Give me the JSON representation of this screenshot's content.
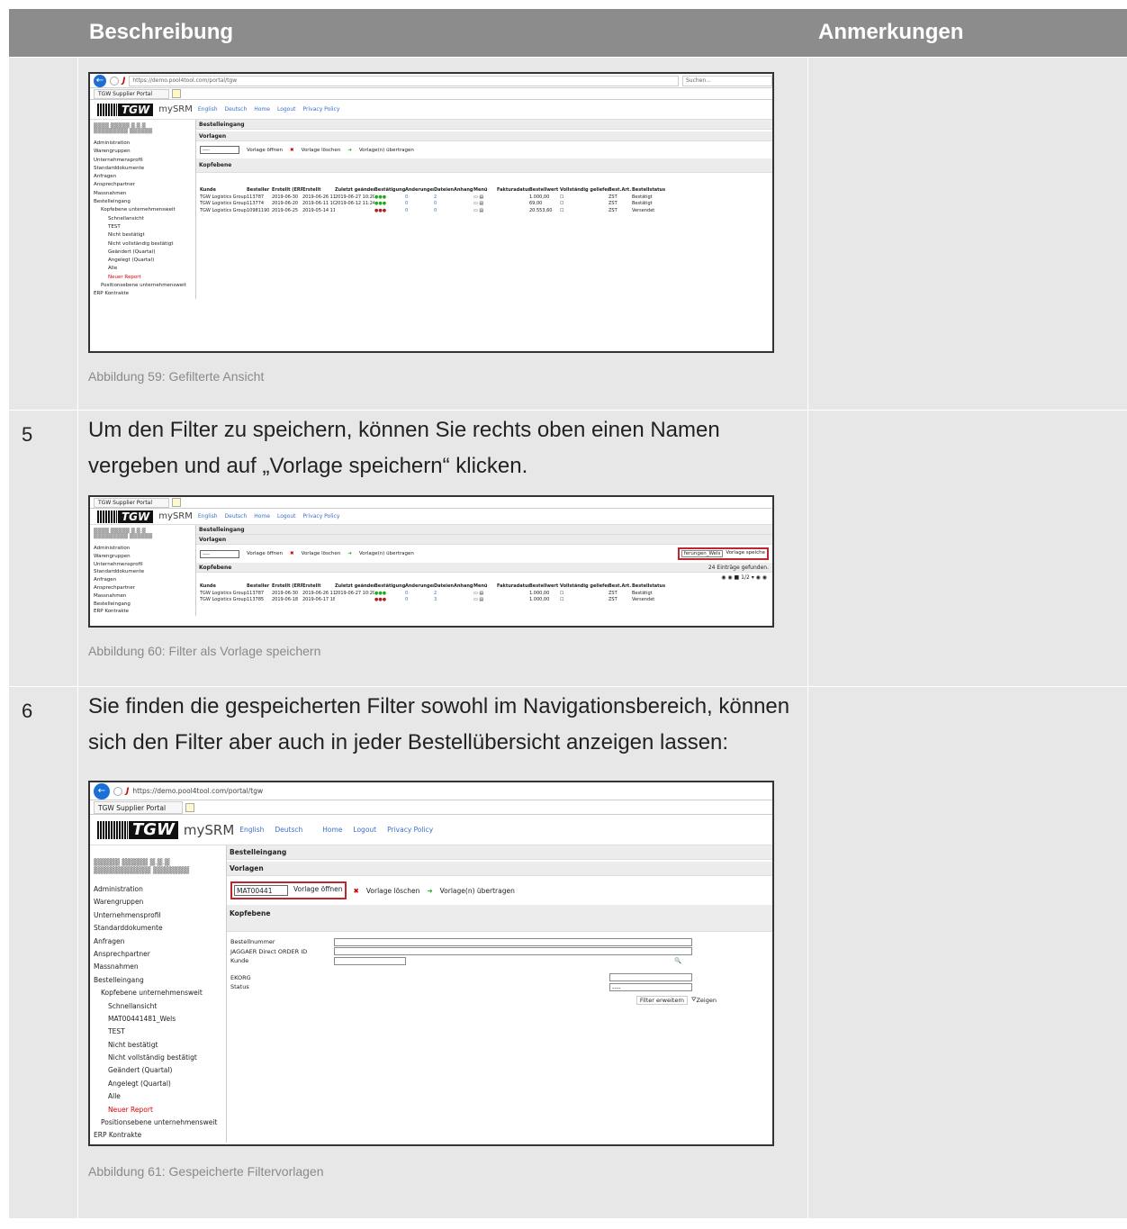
{
  "header": {
    "col_desc": "Beschreibung",
    "col_notes": "Anmerkungen"
  },
  "rows": [
    {
      "num": "",
      "text": "",
      "caption": "Abbildung 59: Gefilterte Ansicht"
    },
    {
      "num": "5",
      "text": "Um den Filter zu speichern, können Sie rechts oben einen Namen vergeben und auf „Vorlage speichern“ klicken.",
      "caption": "Abbildung 60: Filter als Vorlage speichern"
    },
    {
      "num": "6",
      "text": "Sie finden die gespeicherten Filter sowohl im Navigationsbereich, können sich den Filter aber auch in jeder Bestellübersicht anzeigen lassen:",
      "caption": "Abbildung 61: Gespeicherte Filtervorlagen"
    }
  ],
  "app": {
    "url": "https://demo.pool4tool.com/portal/tgw",
    "url_short": "https://demo.pool4tool.com/portal/tgw",
    "search": "Suchen...",
    "tab_title": "TGW Supplier Portal",
    "brand_tgw": "TGW",
    "brand_srm": "mySRM",
    "links": [
      "English",
      "Deutsch",
      "Home",
      "Logout",
      "Privacy Policy"
    ],
    "page_title": "Bestelleingang",
    "vorlagen": "Vorlagen",
    "kopfebene": "Kopfebene",
    "select_default": "----",
    "select_saved": "MAT00441",
    "btn_open": "Vorlage öffnen",
    "btn_delete": "Vorlage löschen",
    "btn_transfer": "Vorlage(n) übertragen",
    "save_name": "ferungen_Wels",
    "btn_save": "Vorlage speiche",
    "found": "24 Einträge gefunden.",
    "pager": "1/2",
    "nav1": [
      "Administration",
      "Warengruppen",
      "Unternehmensprofil",
      "Standarddokumente",
      "Anfragen",
      "Ansprechpartner",
      "Massnahmen",
      "Bestelleingang",
      "Kopfebene unternehmensweit",
      "Schnellansicht",
      "TEST",
      "Nicht bestätigt",
      "Nicht vollständig bestätigt",
      "Geändert (Quartal)",
      "Angelegt (Quartal)",
      "Alle",
      "Neuer Report",
      "Positionsebene unternehmensweit",
      "ERP Kontrakte"
    ],
    "nav2": [
      "Administration",
      "Warengruppen",
      "Unternehmensprofil",
      "Standarddokumente",
      "Anfragen",
      "Ansprechpartner",
      "Massnahmen",
      "Bestelleingang",
      "ERP Kontrakte"
    ],
    "nav3": [
      "Administration",
      "Warengruppen",
      "Unternehmensprofil",
      "Standarddokumente",
      "Anfragen",
      "Ansprechpartner",
      "Massnahmen",
      "Bestelleingang",
      "Kopfebene unternehmensweit",
      "Schnellansicht",
      "MAT00441481_Wels",
      "TEST",
      "Nicht bestätigt",
      "Nicht vollständig bestätigt",
      "Geändert (Quartal)",
      "Angelegt (Quartal)",
      "Alle",
      "Neuer Report",
      "Positionsebene unternehmensweit",
      "ERP Kontrakte"
    ],
    "table_cols": [
      "Kunde",
      "Besteller",
      "Erstellt (ERP)",
      "Erstellt",
      "Zuletzt geändert",
      "Bestätigung",
      "Änderungen",
      "Dateien",
      "Anhang",
      "Menü",
      "Fakturadatum",
      "Bestellwert",
      "Vollständig geliefert",
      "Best.Art.",
      "Bestellstatus"
    ],
    "table_rows": [
      [
        "TGW Logistics Group",
        "113787",
        "2019-06-30",
        "2019-06-26 11:27",
        "2019-06-27 10:20",
        "●●●",
        "0",
        "2",
        "",
        "▭ ▤",
        "",
        "1.000,00",
        "☐",
        "ZST",
        "Bestätigt"
      ],
      [
        "TGW Logistics Group",
        "113774",
        "2019-06-20",
        "2019-06-11 10:22",
        "2019-06-12 11:24",
        "●●●",
        "0",
        "0",
        "",
        "▭ ▤",
        "",
        "69,00",
        "☐",
        "ZST",
        "Bestätigt"
      ],
      [
        "TGW Logistics Group",
        "10981190",
        "2019-06-25",
        "2019-05-14 11:52",
        "",
        "●●●",
        "0",
        "0",
        "",
        "▭ ▤",
        "",
        "20.553,60",
        "☐",
        "ZST",
        "Versendet"
      ]
    ],
    "table2_rows": [
      [
        "TGW Logistics Group",
        "113787",
        "2019-06-30",
        "2019-06-26 11:27",
        "2019-06-27 10:20",
        "●●●",
        "0",
        "2",
        "",
        "▭ ▤",
        "",
        "1.000,00",
        "☐",
        "ZST",
        "Bestätigt"
      ],
      [
        "TGW Logistics Group",
        "113785",
        "2019-06-18",
        "2019-06-17 18:32",
        "",
        "●●●",
        "0",
        "3",
        "",
        "▭ ▤",
        "",
        "1.000,00",
        "☐",
        "ZST",
        "Versendet"
      ]
    ],
    "form": {
      "bestellnummer": "Bestellnummer",
      "jaggaer": "JAGGAER Direct ORDER ID",
      "kunde": "Kunde",
      "ekorg": "EKORG",
      "status": "Status",
      "status_val": "----",
      "filter_more": "Filter erweitern",
      "show": "Zeigen"
    }
  }
}
